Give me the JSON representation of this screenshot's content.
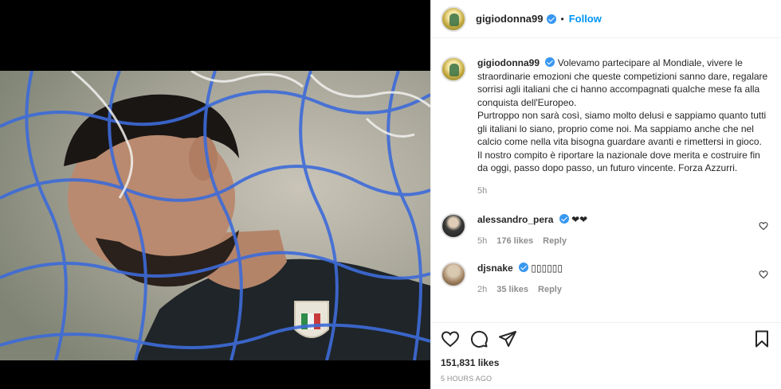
{
  "post": {
    "author": "gigiodonna99",
    "follow_label": "Follow",
    "separator": "•"
  },
  "caption": {
    "author": "gigiodonna99",
    "paragraph_1": "Volevamo partecipare al Mondiale, vivere le straordinarie emozioni che queste competizioni sanno dare, regalare sorrisi agli italiani che ci hanno accompagnati qualche mese fa alla conquista dell'Europeo.",
    "paragraph_2": "Purtroppo non sarà così, siamo molto delusi e sappiamo quanto tutti gli italiani lo siano, proprio come noi. Ma sappiamo anche che nel calcio come nella vita bisogna guardare avanti e rimettersi in gioco. Il nostro compito è riportare la nazionale dove merita e costruire fin da oggi, passo dopo passo, un futuro vincente. Forza Azzurri.",
    "time": "5h"
  },
  "comments": [
    {
      "user": "alessandro_pera",
      "text": "❤❤",
      "time": "5h",
      "likes": "176 likes",
      "reply": "Reply"
    },
    {
      "user": "djsnake",
      "text": "▯▯▯▯▯▯",
      "time": "2h",
      "likes": "35 likes",
      "reply": "Reply"
    }
  ],
  "footer": {
    "likes": "151,831 likes",
    "posted": "5 HOURS AGO"
  },
  "icons": {
    "like": "heart-icon",
    "comment": "comment-icon",
    "share": "share-icon",
    "save": "bookmark-icon",
    "verified": "verified-badge-icon"
  },
  "colors": {
    "accent": "#0095f6",
    "verified": "#3897f0",
    "muted": "#8e8e8e",
    "text": "#262626"
  }
}
